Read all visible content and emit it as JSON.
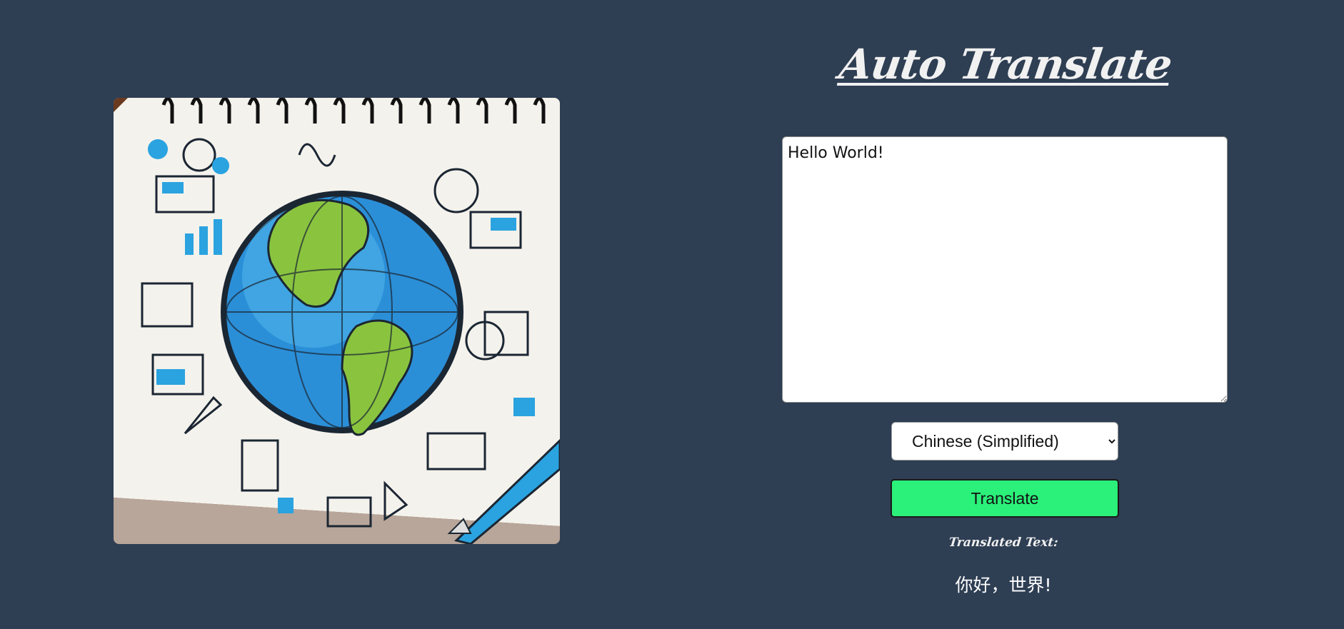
{
  "header": {
    "title": "Auto Translate"
  },
  "image": {
    "alt": "illustration-globe-notebook",
    "colors": {
      "paper": "#f4f2ec",
      "ocean": "#2b8fd8",
      "land": "#8ac43f",
      "ink": "#1b2633",
      "accent": "#2aa3e0"
    }
  },
  "form": {
    "source_text": "Hello World!",
    "language_select": {
      "selected": "Chinese (Simplified)",
      "options": [
        "Chinese (Simplified)"
      ]
    },
    "translate_label": "Translate"
  },
  "result": {
    "label": "Translated Text:",
    "text": "你好，世界!"
  },
  "colors": {
    "background": "#2e3e53",
    "button": "#2bf07a",
    "title": "#f1f1f1"
  }
}
